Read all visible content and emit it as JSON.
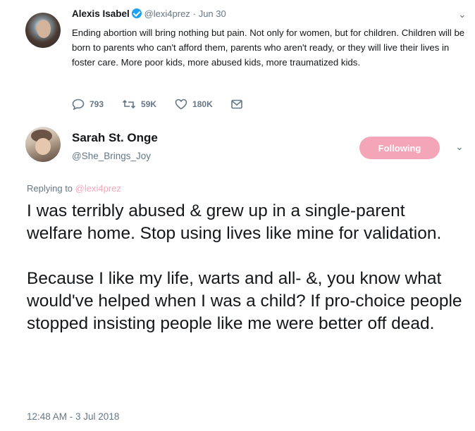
{
  "parent_tweet": {
    "display_name": "Alexis Isabel",
    "handle": "@lexi4prez",
    "separator": "·",
    "date": "Jun 30",
    "text": "Ending abortion will bring nothing but pain. Not only for women, but for children. Children will be born to parents who can't afford them, parents who aren't ready, or they will live their lives in foster care. More poor kids, more abused kids, more traumatized kids.",
    "replies": "793",
    "retweets": "59K",
    "likes": "180K",
    "verified": true
  },
  "reply_tweet": {
    "display_name": "Sarah St. Onge",
    "handle": "@She_Brings_Joy",
    "follow_label": "Following",
    "replying_prefix": "Replying to",
    "replying_to": "@lexi4prez",
    "paragraph_1": "I was terribly abused & grew up in a single-parent welfare home. Stop using lives like mine for validation.",
    "paragraph_2": "Because I like my life, warts and all- &, you know what would've helped when I was a child? If pro-choice people stopped insisting people like me were better off dead.",
    "timestamp": "12:48 AM - 3 Jul 2018"
  },
  "colors": {
    "accent": "#f4a6b8",
    "verified_blue": "#1da1f2",
    "secondary_text": "#657786"
  },
  "icons": [
    "verified-icon",
    "caret-down-icon",
    "reply-icon",
    "retweet-icon",
    "like-icon",
    "dm-icon"
  ]
}
